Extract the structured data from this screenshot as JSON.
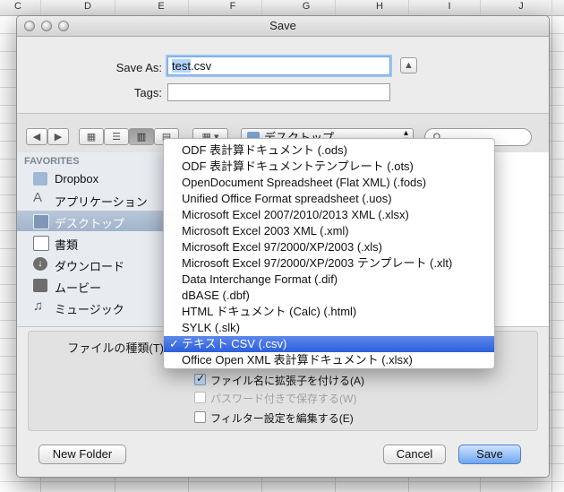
{
  "sheet": {
    "columns": [
      "C",
      "D",
      "E",
      "F",
      "G",
      "H",
      "I",
      "J"
    ]
  },
  "dialog": {
    "title": "Save",
    "save_as_label": "Save As:",
    "save_as_value": "test.csv",
    "save_as_selected": "test",
    "save_as_ext": ".csv",
    "tags_label": "Tags:",
    "tags_value": "",
    "location_label": "デスクトップ",
    "search_placeholder": "",
    "sidebar": {
      "heading": "FAVORITES",
      "items": [
        {
          "label": "Dropbox",
          "icon": "folder-icon"
        },
        {
          "label": "アプリケーション",
          "icon": "applications-icon"
        },
        {
          "label": "デスクトップ",
          "icon": "desktop-icon",
          "selected": true
        },
        {
          "label": "書類",
          "icon": "documents-icon"
        },
        {
          "label": "ダウンロード",
          "icon": "downloads-icon"
        },
        {
          "label": "ムービー",
          "icon": "movies-icon"
        },
        {
          "label": "ミュージック",
          "icon": "music-icon"
        }
      ]
    },
    "filetype_label": "ファイルの種類(T)",
    "options": [
      {
        "label": "ファイル名に拡張子を付ける(A)",
        "checked": true,
        "enabled": true
      },
      {
        "label": "パスワード付きで保存する(W)",
        "checked": false,
        "enabled": false
      },
      {
        "label": "フィルター設定を編集する(E)",
        "checked": false,
        "enabled": true
      }
    ],
    "new_folder": "New Folder",
    "cancel": "Cancel",
    "save": "Save"
  },
  "filetype_menu": {
    "selected_index": 14,
    "items": [
      "ODF 表計算ドキュメント (.ods)",
      "ODF 表計算ドキュメントテンプレート (.ots)",
      "OpenDocument Spreadsheet (Flat XML) (.fods)",
      "Unified Office Format spreadsheet (.uos)",
      "Microsoft Excel 2007/2010/2013 XML (.xlsx)",
      "Microsoft Excel 2003 XML (.xml)",
      "Microsoft Excel 97/2000/XP/2003 (.xls)",
      "Microsoft Excel 97/2000/XP/2003 テンプレート (.xlt)",
      "Data Interchange Format (.dif)",
      "dBASE (.dbf)",
      "HTML ドキュメント (Calc) (.html)",
      "SYLK (.slk)",
      "テキスト CSV (.csv)",
      "Office Open XML 表計算ドキュメント (.xlsx)"
    ],
    "checkmark": "✓"
  },
  "colors": {
    "menu_highlight": "#2c5fdc",
    "sidebar_selected": "#a2b4cb",
    "default_button": "#6ea6f0"
  }
}
